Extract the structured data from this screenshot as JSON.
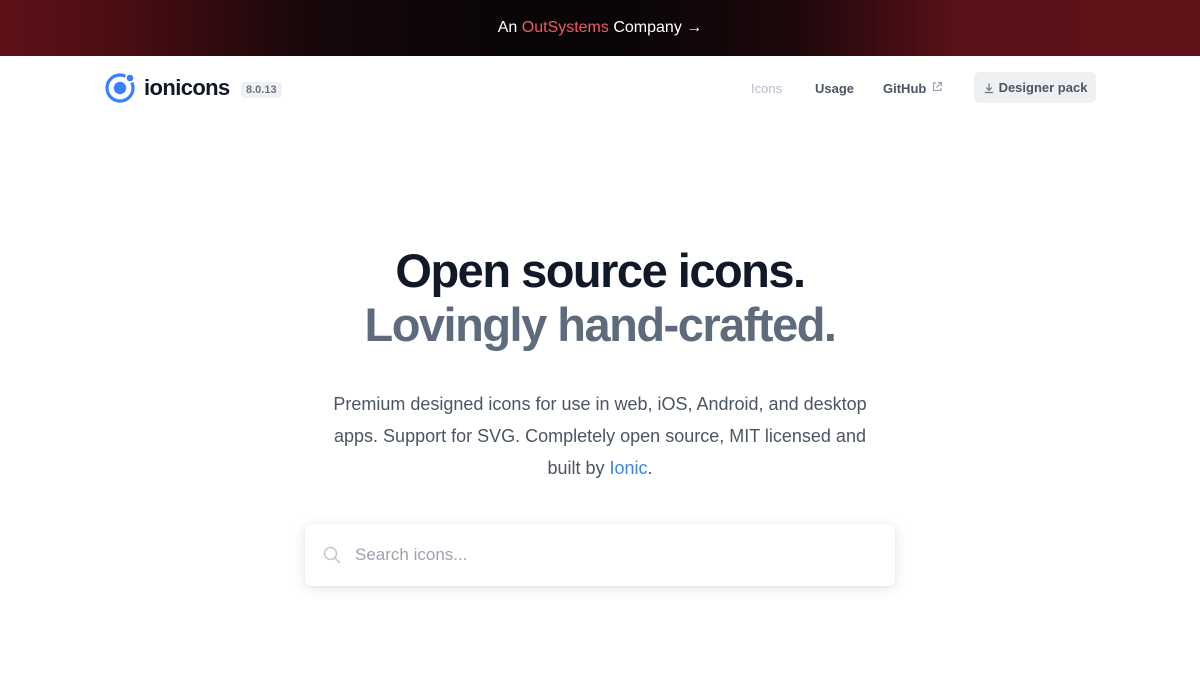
{
  "banner": {
    "prefix": "An ",
    "brand": "OutSystems",
    "suffix": " Company →"
  },
  "header": {
    "logo_text": "ionicons",
    "version": "8.0.13",
    "nav": {
      "icons": "Icons",
      "usage": "Usage",
      "github": "GitHub",
      "designer_pack": "Designer pack"
    }
  },
  "hero": {
    "title_line1": "Open source icons.",
    "title_line2": "Lovingly hand-crafted.",
    "subtitle_text": "Premium designed icons for use in web, iOS, Android, and desktop apps. Support for SVG. Completely open source, MIT licensed and built by ",
    "subtitle_link": "Ionic",
    "subtitle_end": "."
  },
  "search": {
    "placeholder": "Search icons...",
    "value": ""
  },
  "colors": {
    "accent": "#3880ff",
    "brand_red": "#f25a63",
    "title_dark": "#111827",
    "title_gray": "#5d6b7d"
  }
}
